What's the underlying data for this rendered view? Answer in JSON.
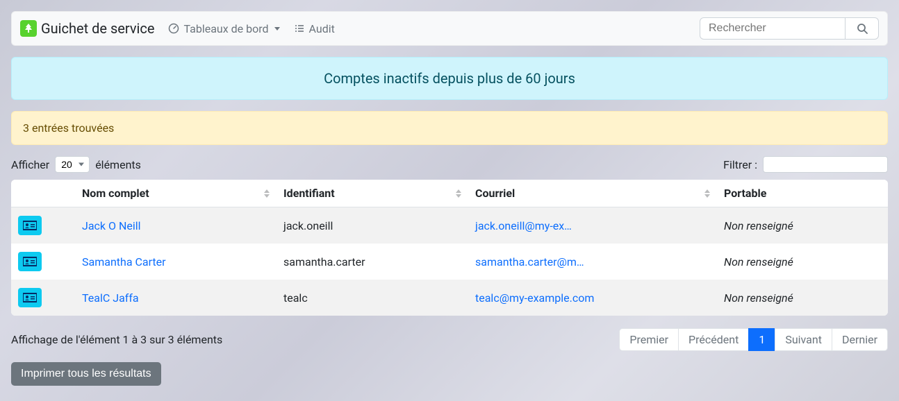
{
  "brand": {
    "title": "Guichet de service"
  },
  "nav": {
    "dashboards": "Tableaux de bord",
    "audit": "Audit"
  },
  "search": {
    "placeholder": "Rechercher"
  },
  "banner": {
    "title": "Comptes inactifs depuis plus de 60 jours"
  },
  "results_summary": "3 entrées trouvées",
  "length": {
    "prefix": "Afficher",
    "suffix": "éléments",
    "value": "20"
  },
  "filter": {
    "label": "Filtrer :"
  },
  "columns": {
    "name": "Nom complet",
    "ident": "Identifiant",
    "email": "Courriel",
    "mobile": "Portable"
  },
  "rows": [
    {
      "name": "Jack O Neill",
      "ident": "jack.oneill",
      "email": "jack.oneill@my-ex…",
      "mobile": "Non renseigné"
    },
    {
      "name": "Samantha Carter",
      "ident": "samantha.carter",
      "email": "samantha.carter@m…",
      "mobile": "Non renseigné"
    },
    {
      "name": "TealC Jaffa",
      "ident": "tealc",
      "email": "tealc@my-example.com",
      "mobile": "Non renseigné"
    }
  ],
  "footer": {
    "info": "Affichage de l'élément 1 à 3 sur 3 éléments"
  },
  "pagination": {
    "first": "Premier",
    "prev": "Précédent",
    "page": "1",
    "next": "Suivant",
    "last": "Dernier"
  },
  "print_label": "Imprimer tous les résultats"
}
